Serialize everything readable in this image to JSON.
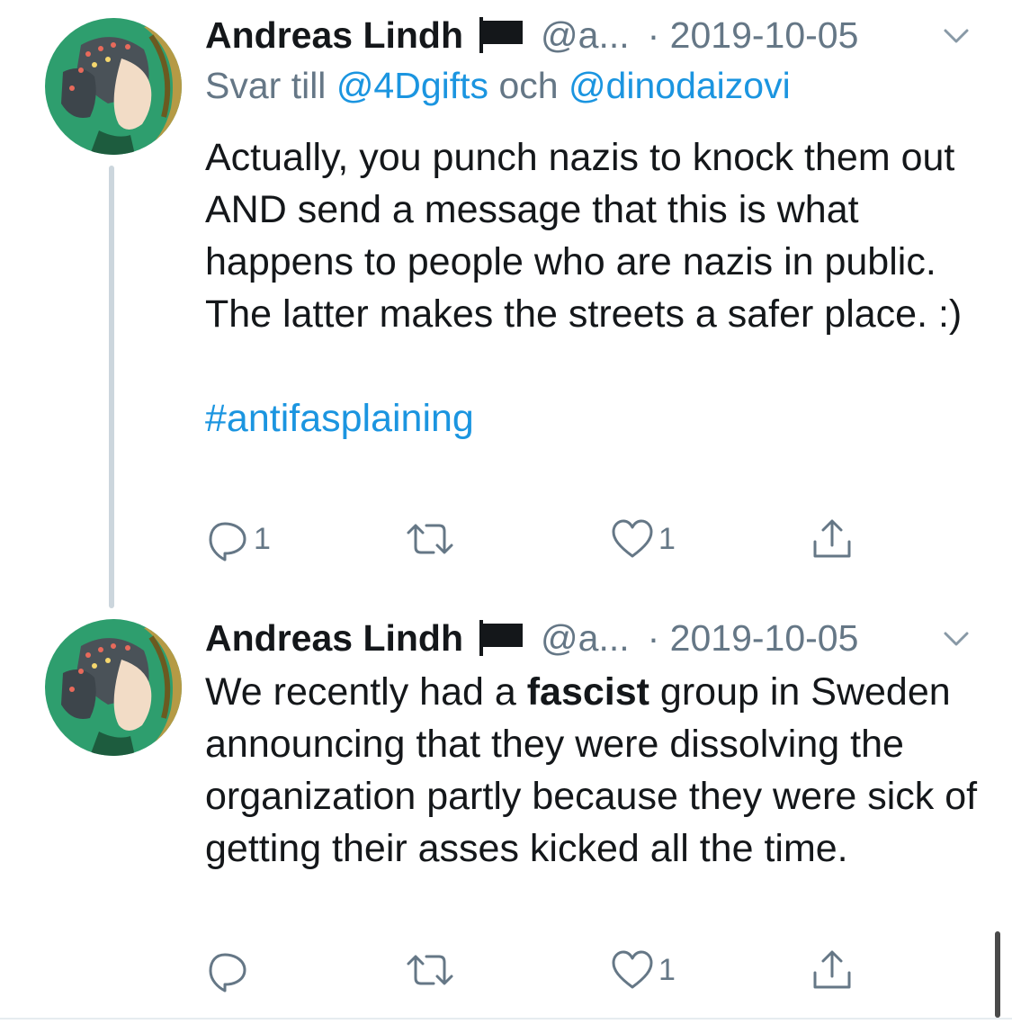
{
  "tweets": [
    {
      "author_name": "Andreas Lindh",
      "handle": "@a...",
      "date": "· 2019-10-05",
      "reply_prefix": "Svar till ",
      "reply_user1": "@4Dgifts",
      "reply_conj": " och ",
      "reply_user2": "@dinodaizovi",
      "body": "Actually, you punch nazis to knock them out AND send a message that this is what happens to people who are nazis in public. The latter makes the streets a safer place. :)",
      "hashtag": "#antifasplaining",
      "reply_count": "1",
      "like_count": "1"
    },
    {
      "author_name": "Andreas Lindh",
      "handle": "@a...",
      "date": "· 2019-10-05",
      "body_pre": "We recently had a ",
      "body_bold": "fascist",
      "body_post": " group in Sweden announcing that they were dissolving the organization partly because they were sick of getting their asses kicked all the time.",
      "like_count": "1"
    }
  ],
  "colors": {
    "link": "#1b95e0",
    "secondary_text": "#657786",
    "thread_line": "#ccd6dd",
    "avatar_bg": "#2e9e6e"
  },
  "icons": [
    "flag-icon",
    "chevron-down-icon",
    "reply-icon",
    "retweet-icon",
    "like-icon",
    "share-icon"
  ]
}
